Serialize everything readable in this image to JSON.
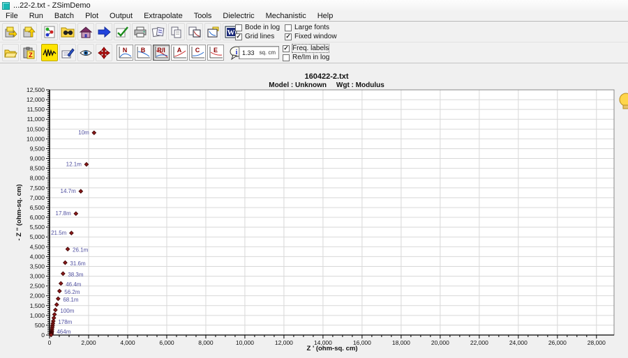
{
  "titlebar": {
    "title": "...22-2.txt - ZSimDemo"
  },
  "menu": {
    "items": [
      "File",
      "Run",
      "Batch",
      "Plot",
      "Output",
      "Extrapolate",
      "Tools",
      "Dielectric",
      "Mechanistic",
      "Help"
    ]
  },
  "toolbar1": {
    "checkboxes": [
      {
        "label": "Bode in log",
        "checked": false,
        "mark": ""
      },
      {
        "label": "Grid lines",
        "checked": true,
        "mark": "✓"
      },
      {
        "label": "Large fonts",
        "checked": false,
        "mark": ""
      },
      {
        "label": "Fixed window",
        "checked": true,
        "mark": "✓"
      }
    ],
    "word_icon_letter": "W"
  },
  "toolbar2": {
    "plot_buttons": [
      {
        "label": "N",
        "pressed": false
      },
      {
        "label": "B",
        "pressed": false
      },
      {
        "label": "R/I",
        "pressed": true
      },
      {
        "label": "A",
        "pressed": false
      },
      {
        "label": "C",
        "pressed": false
      },
      {
        "label": "E",
        "pressed": false
      }
    ],
    "info_icon_letter": "i",
    "paste_icon_letter": "Z",
    "area_value": "1.33",
    "area_unit": "sq. cm",
    "checkboxes": [
      {
        "label": "Freq. labels",
        "checked": true,
        "mark": "✓"
      },
      {
        "label": "Re/Im in log",
        "checked": false,
        "mark": ""
      }
    ]
  },
  "chart_data": {
    "type": "scatter",
    "title": "160422-2.txt",
    "model_label": "Model : Unknown",
    "wgt_label": "Wgt : Modulus",
    "xlabel": "Z ' (ohm-sq. cm)",
    "ylabel": "- Z '' (ohm-sq. cm)",
    "xlim": [
      0,
      28900
    ],
    "ylim": [
      0,
      12500
    ],
    "x_major": 2000,
    "x_minor": 500,
    "y_major": 500,
    "y_minor": 100,
    "grid": true,
    "grid_color": "#d8d8d8",
    "marker_color": "#8b1a1a",
    "marker_edge_color": "#3a0000",
    "freq_label_color": "#5050a0",
    "points": [
      {
        "freq": "10m",
        "zre": 2280,
        "zim": 10310,
        "side": "left"
      },
      {
        "freq": "12.1m",
        "zre": 1890,
        "zim": 8700,
        "side": "left"
      },
      {
        "freq": "14.7m",
        "zre": 1600,
        "zim": 7330,
        "side": "left"
      },
      {
        "freq": "17.8m",
        "zre": 1350,
        "zim": 6190,
        "side": "left"
      },
      {
        "freq": "21.5m",
        "zre": 1120,
        "zim": 5200,
        "side": "left"
      },
      {
        "freq": "26.1m",
        "zre": 930,
        "zim": 4380,
        "side": "right"
      },
      {
        "freq": "31.6m",
        "zre": 800,
        "zim": 3690,
        "side": "right"
      },
      {
        "freq": "38.3m",
        "zre": 690,
        "zim": 3130,
        "side": "right"
      },
      {
        "freq": "46.4m",
        "zre": 580,
        "zim": 2630,
        "side": "right"
      },
      {
        "freq": "56.2m",
        "zre": 510,
        "zim": 2240,
        "side": "right"
      },
      {
        "freq": "68.1m",
        "zre": 440,
        "zim": 1850,
        "side": "right"
      },
      {
        "freq": "",
        "zre": 365,
        "zim": 1550,
        "side": ""
      },
      {
        "freq": "100m",
        "zre": 300,
        "zim": 1280,
        "side": "right"
      },
      {
        "freq": "",
        "zre": 255,
        "zim": 1050,
        "side": ""
      },
      {
        "freq": "",
        "zre": 220,
        "zim": 870,
        "side": ""
      },
      {
        "freq": "178m",
        "zre": 190,
        "zim": 710,
        "side": "right"
      },
      {
        "freq": "",
        "zre": 170,
        "zim": 590,
        "side": ""
      },
      {
        "freq": "",
        "zre": 155,
        "zim": 490,
        "side": ""
      },
      {
        "freq": "",
        "zre": 143,
        "zim": 400,
        "side": ""
      },
      {
        "freq": "",
        "zre": 130,
        "zim": 300,
        "side": ""
      },
      {
        "freq": "464m",
        "zre": 120,
        "zim": 210,
        "side": "right"
      },
      {
        "freq": "",
        "zre": 112,
        "zim": 150,
        "side": ""
      },
      {
        "freq": "",
        "zre": 104,
        "zim": 105,
        "side": ""
      },
      {
        "freq": "",
        "zre": 97,
        "zim": 70,
        "side": ""
      },
      {
        "freq": "",
        "zre": 91,
        "zim": 45,
        "side": ""
      },
      {
        "freq": "",
        "zre": 86,
        "zim": 25,
        "side": ""
      },
      {
        "freq": "",
        "zre": 81,
        "zim": 10,
        "side": ""
      }
    ]
  }
}
